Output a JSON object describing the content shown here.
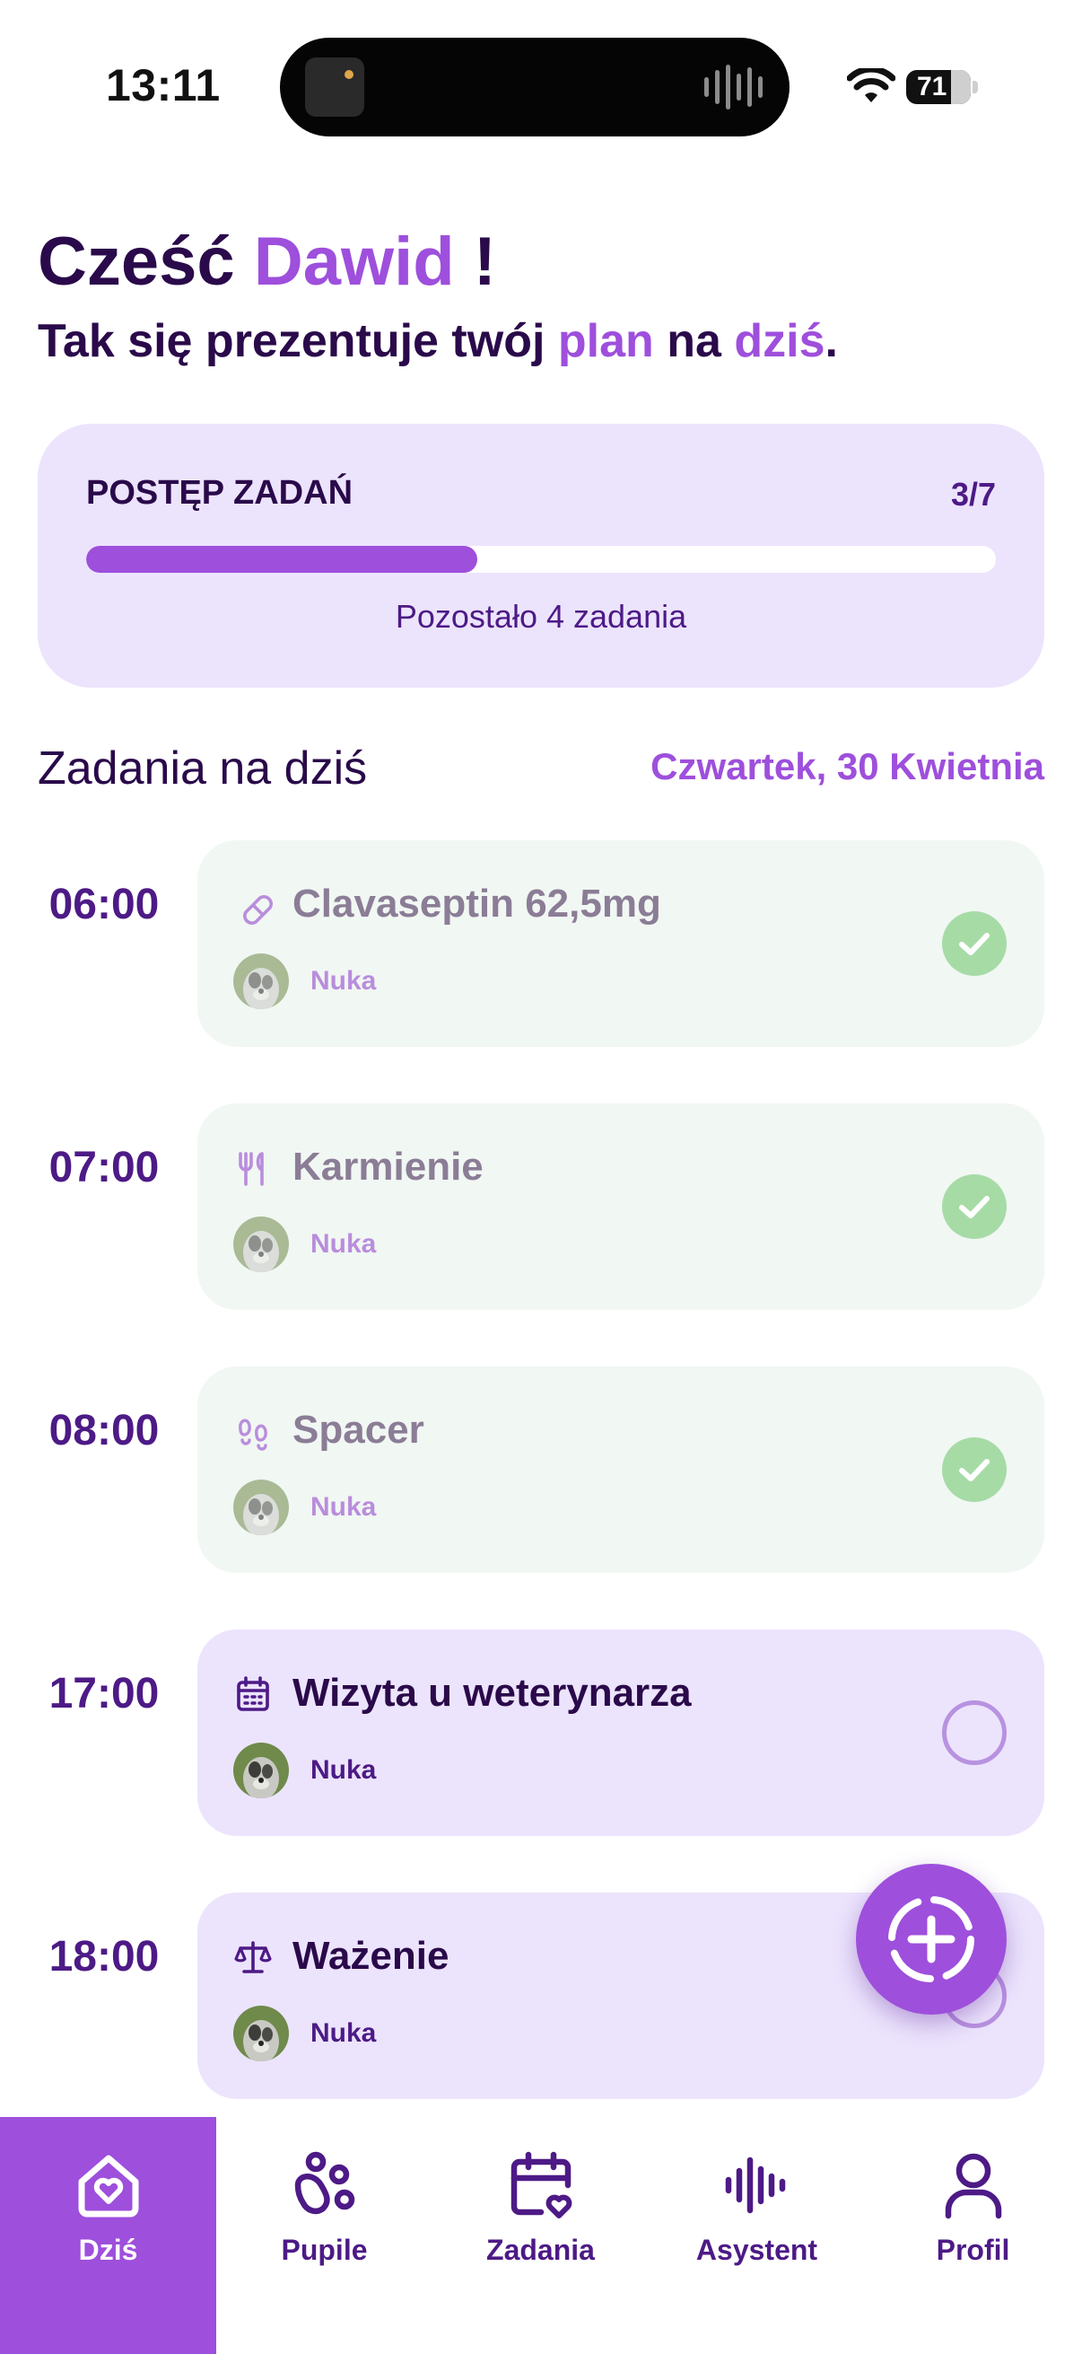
{
  "status_bar": {
    "time": "13:11",
    "battery": "71"
  },
  "greeting": {
    "prefix": "Cześć",
    "name": "Dawid",
    "suffix": "!",
    "sub_start": "Tak się prezentuje twój",
    "sub_plan": "plan",
    "sub_mid": "na",
    "sub_today": "dziś",
    "sub_end": "."
  },
  "progress": {
    "title": "POSTĘP ZADAŃ",
    "count": "3/7",
    "fraction": 0.43,
    "remaining": "Pozostało 4 zadania"
  },
  "section": {
    "title": "Zadania na dziś",
    "date": "Czwartek, 30 Kwietnia"
  },
  "tasks": [
    {
      "time": "06:00",
      "title": "Clavaseptin 62,5mg",
      "pet": "Nuka",
      "icon": "pill-icon",
      "done": true
    },
    {
      "time": "07:00",
      "title": "Karmienie",
      "pet": "Nuka",
      "icon": "fork-knife-icon",
      "done": true
    },
    {
      "time": "08:00",
      "title": "Spacer",
      "pet": "Nuka",
      "icon": "footprints-icon",
      "done": true
    },
    {
      "time": "17:00",
      "title": "Wizyta u weterynarza",
      "pet": "Nuka",
      "icon": "calendar-icon",
      "done": false
    },
    {
      "time": "18:00",
      "title": "Ważenie",
      "pet": "Nuka",
      "icon": "scale-icon",
      "done": false
    }
  ],
  "nav": [
    {
      "label": "Dziś",
      "icon": "home-heart-icon",
      "active": true
    },
    {
      "label": "Pupile",
      "icon": "paw-icon",
      "active": false
    },
    {
      "label": "Zadania",
      "icon": "calendar-heart-icon",
      "active": false
    },
    {
      "label": "Asystent",
      "icon": "voice-wave-icon",
      "active": false
    },
    {
      "label": "Profil",
      "icon": "user-icon",
      "active": false
    }
  ],
  "colors": {
    "accent": "#9e4fdc",
    "dark_text": "#2a0a4a",
    "card_lavender": "#ece4fd",
    "card_done": "#f1f7f3",
    "check_green": "#a6dba6"
  }
}
